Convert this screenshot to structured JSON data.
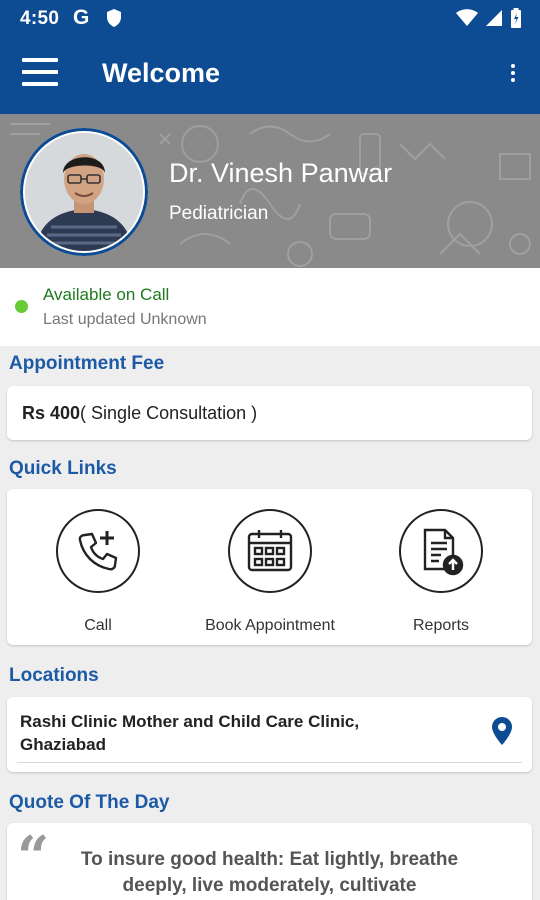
{
  "status_bar": {
    "time": "4:50",
    "g_label": "G"
  },
  "app_bar": {
    "title": "Welcome"
  },
  "doctor": {
    "name": "Dr. Vinesh Panwar",
    "specialty": "Pediatrician"
  },
  "availability": {
    "status": "Available on Call",
    "updated": "Last updated Unknown",
    "color": "#66cc33"
  },
  "appointment_fee": {
    "title": "Appointment Fee",
    "amount": "Rs 400",
    "detail": "( Single Consultation )"
  },
  "quick_links": {
    "title": "Quick Links",
    "items": [
      {
        "label": "Call",
        "icon": "phone-plus-icon"
      },
      {
        "label": "Book Appointment",
        "icon": "calendar-icon"
      },
      {
        "label": "Reports",
        "icon": "report-upload-icon"
      }
    ]
  },
  "locations": {
    "title": "Locations",
    "items": [
      {
        "name": "Rashi Clinic Mother and Child Care Clinic, Ghaziabad"
      }
    ]
  },
  "quote_of_day": {
    "title": "Quote Of The Day",
    "text": "To insure good health: Eat lightly, breathe deeply, live moderately, cultivate"
  },
  "colors": {
    "primary": "#0d4c93",
    "section_title": "#1d5aa6",
    "available": "#1f7a1f"
  }
}
